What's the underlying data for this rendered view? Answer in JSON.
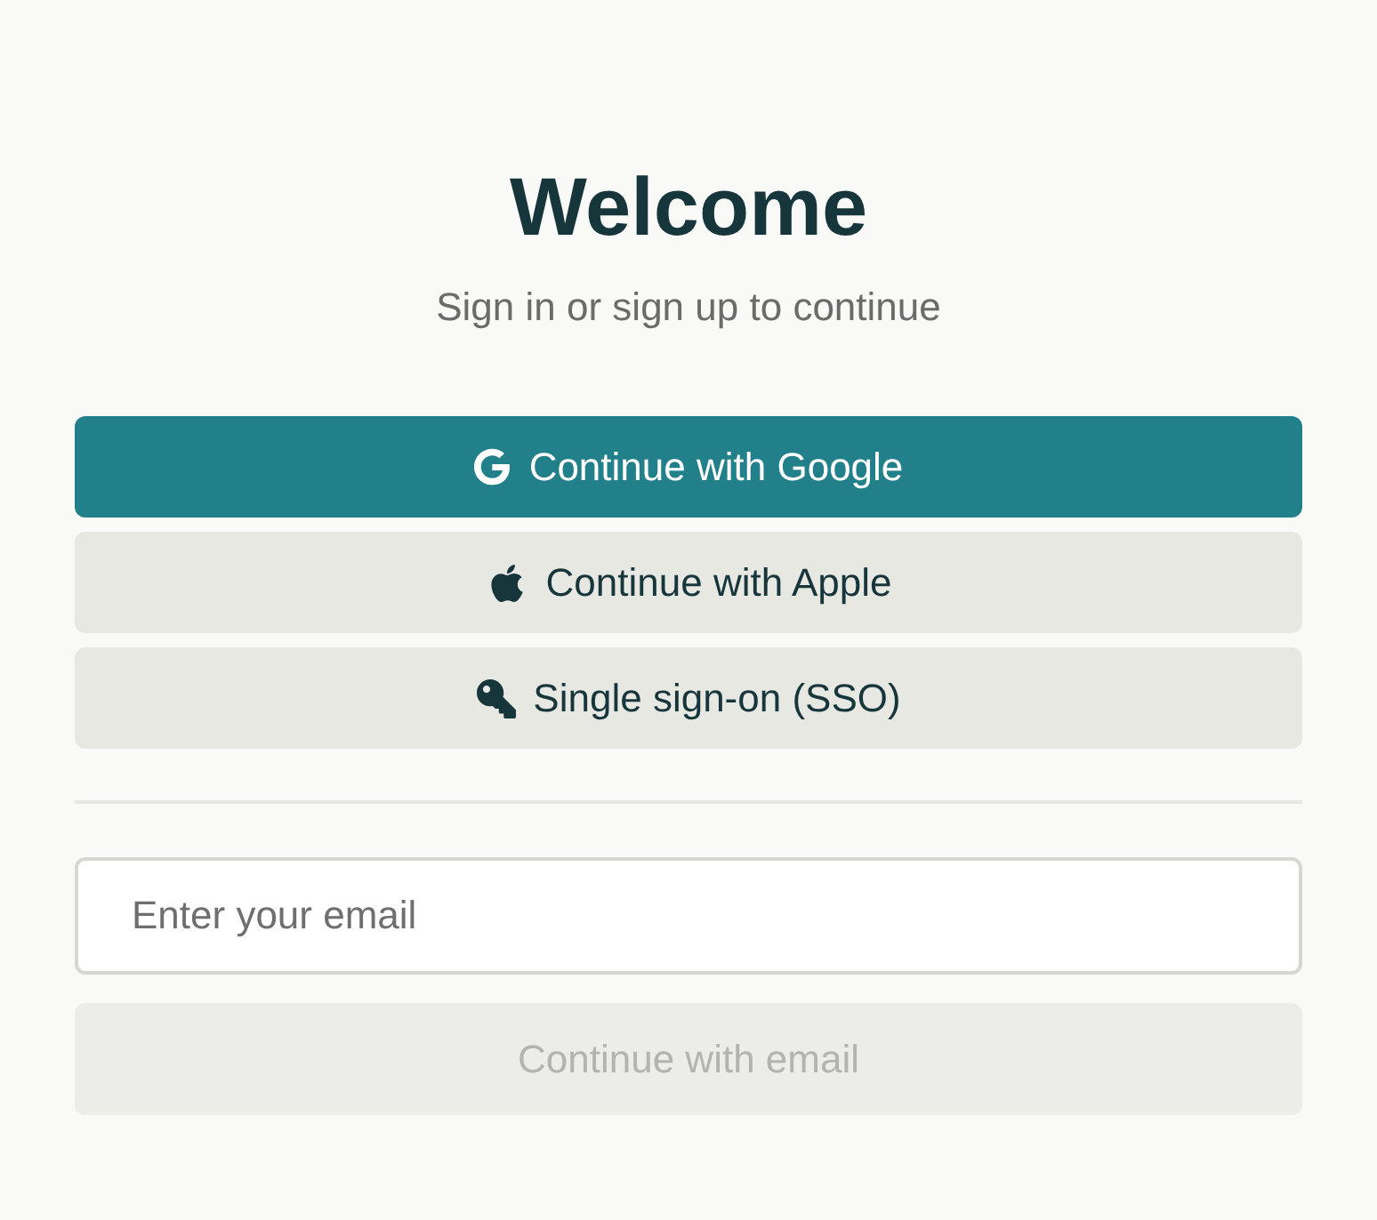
{
  "title": "Welcome",
  "subtitle": "Sign in or sign up to continue",
  "buttons": [
    {
      "kind": "google",
      "label": "Continue with Google"
    },
    {
      "kind": "apple",
      "label": "Continue with Apple"
    },
    {
      "kind": "sso",
      "label": "Single sign-on (SSO)"
    }
  ],
  "email": {
    "placeholder": "Enter your email"
  },
  "submit": {
    "label": "Continue with email",
    "disabled": true
  }
}
